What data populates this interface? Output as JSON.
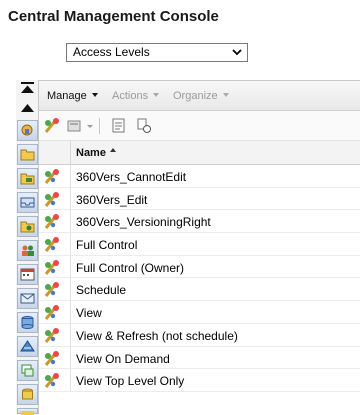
{
  "app": {
    "title": "Central Management Console"
  },
  "selector": {
    "value": "Access Levels"
  },
  "menubar": {
    "items": [
      {
        "label": "Manage",
        "enabled": true
      },
      {
        "label": "Actions",
        "enabled": false
      },
      {
        "label": "Organize",
        "enabled": false
      }
    ]
  },
  "grid": {
    "column_header": "Name",
    "sort": "ascending",
    "rows": [
      {
        "name": "360Vers_CannotEdit"
      },
      {
        "name": "360Vers_Edit"
      },
      {
        "name": "360Vers_VersioningRight"
      },
      {
        "name": "Full Control"
      },
      {
        "name": "Full Control (Owner)"
      },
      {
        "name": "Schedule"
      },
      {
        "name": "View"
      },
      {
        "name": "View & Refresh (not schedule)"
      },
      {
        "name": "View On Demand"
      },
      {
        "name": "View Top Level Only"
      }
    ]
  },
  "rail": {
    "icons": [
      "access-levels-icon",
      "folders-icon",
      "categories-icon",
      "inbox-icon",
      "personal-folders-icon",
      "users-groups-icon",
      "calendars-icon",
      "events-icon",
      "servers-icon",
      "server-groups-icon",
      "sessions-icon",
      "applications-icon",
      "instances-icon"
    ]
  }
}
